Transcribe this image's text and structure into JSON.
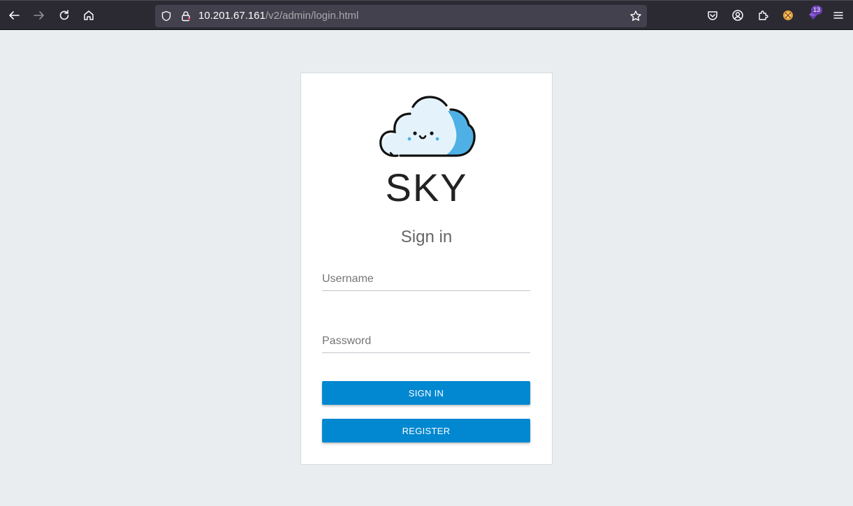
{
  "browser": {
    "url_host": "10.201.67.161",
    "url_path": "/v2/admin/login.html",
    "extension_badge_count": "13",
    "icons": [
      "back-arrow-icon",
      "forward-arrow-icon",
      "reload-icon",
      "home-icon",
      "shield-icon",
      "lock-icon",
      "bookmark-star-icon",
      "pocket-icon",
      "account-icon",
      "extensions-icon",
      "extension-icon",
      "menu-icon"
    ]
  },
  "login": {
    "brand": "SKY",
    "title": "Sign in",
    "username_placeholder": "Username",
    "password_placeholder": "Password",
    "sign_in_label": "SIGN IN",
    "register_label": "REGISTER"
  },
  "colors": {
    "accent": "#0288d1",
    "background": "#e9edf0",
    "toolbar": "#2b2a33"
  }
}
